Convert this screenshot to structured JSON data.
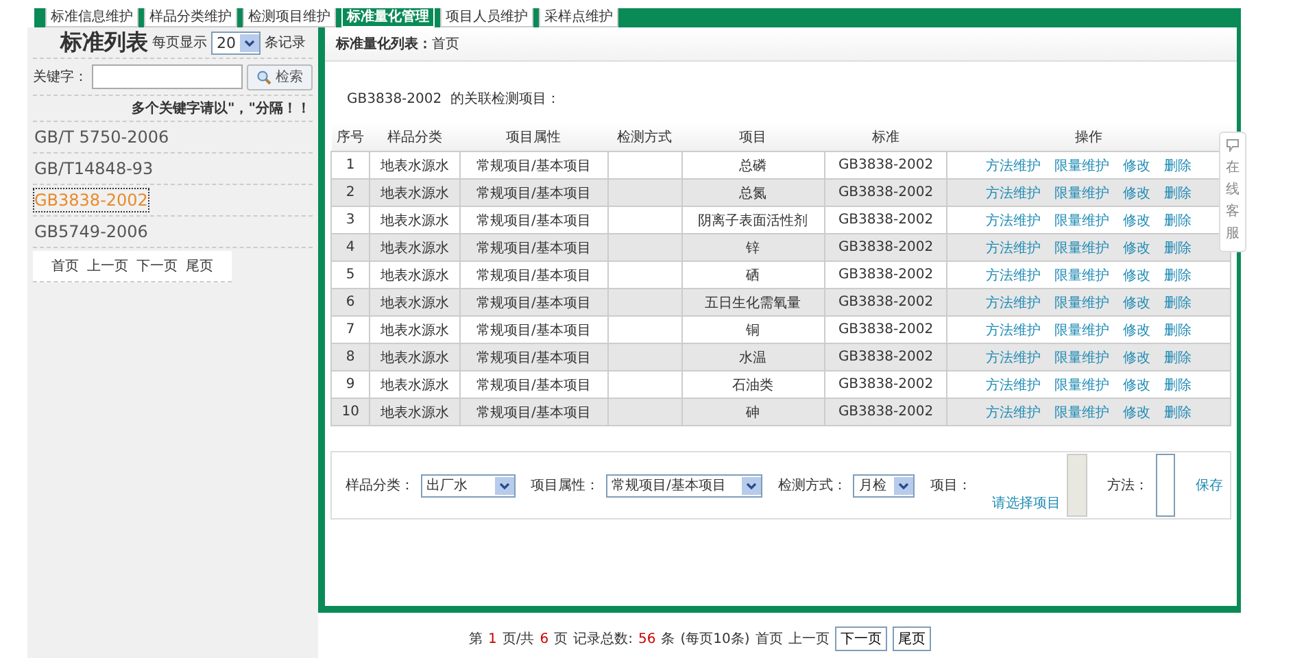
{
  "nav_tabs": [
    {
      "label": "标准信息维护",
      "selected": false
    },
    {
      "label": "样品分类维护",
      "selected": false
    },
    {
      "label": "检测项目维护",
      "selected": false
    },
    {
      "label": "标准量化管理",
      "selected": true
    },
    {
      "label": "项目人员维护",
      "selected": false
    },
    {
      "label": "采样点维护",
      "selected": false
    }
  ],
  "sidebar": {
    "title": "标准列表",
    "per_page_label": "每页显示",
    "per_page": "20",
    "per_page_unit": "条记录",
    "keyword_label": "关键字：",
    "search_button": "检索",
    "hint": "多个关键字请以\"，\"分隔！！",
    "items": [
      {
        "label": "GB/T 5750-2006",
        "selected": false
      },
      {
        "label": "GB/T14848-93",
        "selected": false
      },
      {
        "label": "GB3838-2002",
        "selected": true
      },
      {
        "label": "GB5749-2006",
        "selected": false
      }
    ],
    "pager": [
      "首页",
      "上一页",
      "下一页",
      "尾页"
    ]
  },
  "main": {
    "breadcrumb_label": "标准量化列表：",
    "breadcrumb": "首页",
    "caption": "GB3838-2002  的关联检测项目：",
    "table": {
      "columns": [
        "序号",
        "样品分类",
        "项目属性",
        "检测方式",
        "项目",
        "标准",
        "操作"
      ],
      "rows": [
        {
          "no": "1",
          "category": "地表水源水",
          "attribute": "常规项目/基本项目",
          "item": "总磷",
          "standard": "GB3838-2002",
          "actions": [
            "方法维护",
            "限量维护",
            "修改",
            "删除"
          ]
        },
        {
          "no": "2",
          "category": "地表水源水",
          "attribute": "常规项目/基本项目",
          "item": "总氮",
          "standard": "GB3838-2002",
          "actions": [
            "方法维护",
            "限量维护",
            "修改",
            "删除"
          ]
        },
        {
          "no": "3",
          "category": "地表水源水",
          "attribute": "常规项目/基本项目",
          "item": "阴离子表面活性剂",
          "standard": "GB3838-2002",
          "actions": [
            "方法维护",
            "限量维护",
            "修改",
            "删除"
          ]
        },
        {
          "no": "4",
          "category": "地表水源水",
          "attribute": "常规项目/基本项目",
          "item": "锌",
          "standard": "GB3838-2002",
          "actions": [
            "方法维护",
            "限量维护",
            "修改",
            "删除"
          ]
        },
        {
          "no": "5",
          "category": "地表水源水",
          "attribute": "常规项目/基本项目",
          "item": "硒",
          "standard": "GB3838-2002",
          "actions": [
            "方法维护",
            "限量维护",
            "修改",
            "删除"
          ]
        },
        {
          "no": "6",
          "category": "地表水源水",
          "attribute": "常规项目/基本项目",
          "item": "五日生化需氧量",
          "standard": "GB3838-2002",
          "actions": [
            "方法维护",
            "限量维护",
            "修改",
            "删除"
          ]
        },
        {
          "no": "7",
          "category": "地表水源水",
          "attribute": "常规项目/基本项目",
          "item": "铜",
          "standard": "GB3838-2002",
          "actions": [
            "方法维护",
            "限量维护",
            "修改",
            "删除"
          ]
        },
        {
          "no": "8",
          "category": "地表水源水",
          "attribute": "常规项目/基本项目",
          "item": "水温",
          "standard": "GB3838-2002",
          "actions": [
            "方法维护",
            "限量维护",
            "修改",
            "删除"
          ]
        },
        {
          "no": "9",
          "category": "地表水源水",
          "attribute": "常规项目/基本项目",
          "item": "石油类",
          "standard": "GB3838-2002",
          "actions": [
            "方法维护",
            "限量维护",
            "修改",
            "删除"
          ]
        },
        {
          "no": "10",
          "category": "地表水源水",
          "attribute": "常规项目/基本项目",
          "item": "砷",
          "standard": "GB3838-2002",
          "actions": [
            "方法维护",
            "限量维护",
            "修改",
            "删除"
          ]
        }
      ]
    },
    "form": {
      "selects": [
        {
          "label": "样品分类：",
          "value": "出厂水"
        },
        {
          "label": "项目属性：",
          "value": "常规项目/基本项目"
        },
        {
          "label": "检测方式：",
          "value": "月检"
        }
      ],
      "item": {
        "label": "项目：",
        "link": "请选择项目",
        "disabled": true
      },
      "method": {
        "label": "方法：",
        "disabled": false
      },
      "save": "保存"
    }
  },
  "pagination": [
    {
      "kind": "text",
      "text": "第"
    },
    {
      "kind": "number",
      "text": "1"
    },
    {
      "kind": "text",
      "text": "页/共"
    },
    {
      "kind": "number",
      "text": "6"
    },
    {
      "kind": "text",
      "text": "页"
    },
    {
      "kind": "text",
      "text": "记录总数:"
    },
    {
      "kind": "number",
      "text": "56"
    },
    {
      "kind": "text",
      "text": "条"
    },
    {
      "kind": "text",
      "text": "(每页10条)"
    },
    {
      "kind": "link",
      "text": "首页"
    },
    {
      "kind": "link",
      "text": "上一页"
    },
    {
      "kind": "button",
      "text": "下一页"
    },
    {
      "kind": "button",
      "text": "尾页"
    }
  ],
  "chat_widget": {
    "label": "在线客服"
  }
}
